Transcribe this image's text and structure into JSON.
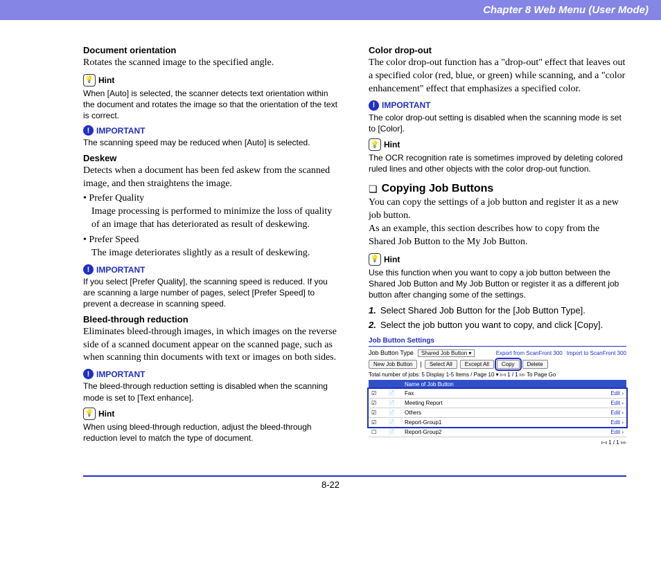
{
  "header": "Chapter 8   Web Menu (User Mode)",
  "labels": {
    "hint": "Hint",
    "important": "IMPORTANT"
  },
  "left": {
    "h1": "Document orientation",
    "p1": "Rotates the scanned image to the specified angle.",
    "hint1": "When [Auto] is selected, the scanner detects text orientation within the document and rotates the image so that the orientation of the text is correct.",
    "imp1": "The scanning speed may be reduced when [Auto] is selected.",
    "h2": "Deskew",
    "p2": "Detects when a document has been fed askew from the scanned image, and then straightens the image.",
    "b1": "• Prefer Quality",
    "b1b": "Image processing is performed to minimize the loss of quality of an image that has deteriorated as result of deskewing.",
    "b2": "• Prefer Speed",
    "b2b": "The image deteriorates slightly as a result of deskewing.",
    "imp2": "If you select [Prefer Quality], the scanning speed is reduced. If you are scanning a large number of pages, select [Prefer Speed] to prevent a decrease in scanning speed.",
    "h3": "Bleed-through reduction",
    "p3": "Eliminates bleed-through images, in which images on the reverse side of a scanned document appear on the scanned page, such as when scanning thin documents with text or images on both sides.",
    "imp3": "The bleed-through reduction setting is disabled when the scanning mode is set to [Text enhance].",
    "hint2": "When using bleed-through reduction, adjust the bleed-through reduction level to match the type of document."
  },
  "right": {
    "h1": "Color drop-out",
    "p1": "The color drop-out function has a \"drop-out\" effect that leaves out a specified color (red, blue, or green) while scanning, and a \"color enhancement\" effect that emphasizes a specified color.",
    "imp1": "The color drop-out setting is disabled when the scanning mode is set to [Color].",
    "hint1": "The OCR recognition rate is sometimes improved by deleting colored ruled lines and other objects with the color drop-out function.",
    "sec": "Copying Job Buttons",
    "secp": "You can copy the settings of a job button and register it as a new job button.\nAs an example, this section describes how to copy from the Shared Job Button to the My Job Button.",
    "hint2": "Use this function when you want to copy a job button between the Shared Job Button and My Job Button or register it as a different job button after changing some of the settings.",
    "step1": "Select Shared Job Button for the [Job Button Type].",
    "step2": "Select the job button you want to copy, and click [Copy]."
  },
  "shot": {
    "title": "Job Button Settings",
    "typeLabel": "Job Button Type",
    "typeValue": "Shared Job Button ▾",
    "export": "Export from ScanFront 300",
    "import": "Import to ScanFront 300",
    "btns": [
      "New Job Button",
      "Select All",
      "Except All",
      "Copy",
      "Delete"
    ],
    "meta": "Total number of jobs: 5 Display   1-5     Items / Page   10  ▾   ▹◃ 1 / 1 ▹▹   To        Page  Go",
    "cols": [
      "",
      "",
      "Name of Job Button",
      ""
    ],
    "rows": [
      {
        "c": true,
        "n": "Fax",
        "e": "Edit ›"
      },
      {
        "c": true,
        "n": "Meeting Report",
        "e": "Edit ›"
      },
      {
        "c": true,
        "n": "Others",
        "e": "Edit ›"
      },
      {
        "c": true,
        "n": "Report-Group1",
        "e": "Edit ›"
      },
      {
        "c": false,
        "n": "Report-Group2",
        "e": "Edit ›"
      }
    ],
    "pager": "▹◃ 1 / 1 ▹▹"
  },
  "pagenum": "8-22"
}
